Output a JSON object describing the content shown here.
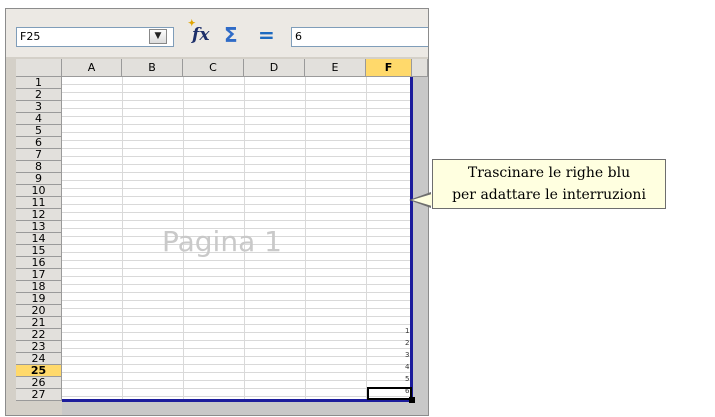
{
  "toolbar": {
    "name_box": "F25",
    "name_box_dropdown_icon": "chevron-down-icon",
    "function_wizard_icon": "function-wizard-icon",
    "sum_icon": "sum-icon",
    "equals_icon": "equals-icon",
    "formula_value": "6"
  },
  "columns": [
    "A",
    "B",
    "C",
    "D",
    "E",
    "F"
  ],
  "active_column": "F",
  "rows": [
    "1",
    "2",
    "3",
    "4",
    "5",
    "6",
    "7",
    "8",
    "9",
    "10",
    "11",
    "12",
    "13",
    "14",
    "15",
    "16",
    "17",
    "18",
    "19",
    "20",
    "21",
    "22",
    "23",
    "24",
    "25",
    "26",
    "27"
  ],
  "active_row": "25",
  "sheet": {
    "page_label": "Pagina 1",
    "clipped_cells": [
      "1",
      "2",
      "3",
      "4",
      "5",
      "6"
    ]
  },
  "callout": {
    "line1": "Trascinare le righe blu",
    "line2": "per adattare le interruzioni"
  },
  "colors": {
    "page_break": "#1c1c9c",
    "active_header": "#ffd96b",
    "callout_bg": "#ffffe0"
  }
}
